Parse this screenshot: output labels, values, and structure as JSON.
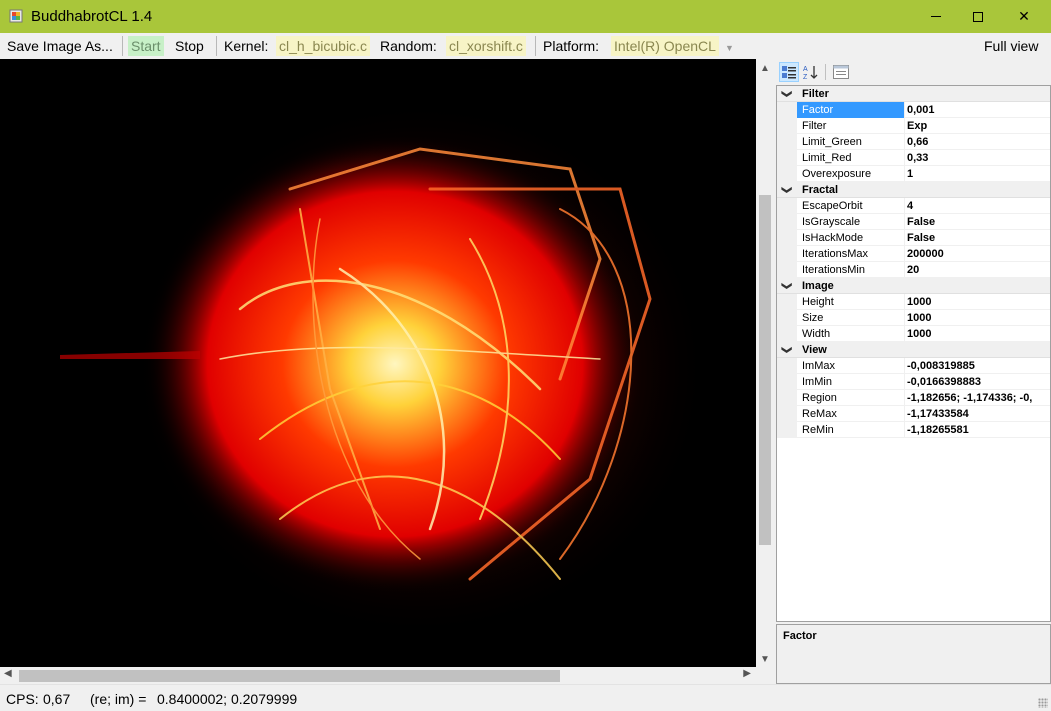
{
  "window": {
    "title": "BuddhabrotCL 1.4",
    "minimize_icon": "minimize-icon",
    "maximize_icon": "maximize-icon",
    "close_glyph": "✕"
  },
  "toolbar": {
    "save_label": "Save Image As...",
    "start_label": "Start",
    "stop_label": "Stop",
    "kernel_label": "Kernel:",
    "kernel_value": "cl_h_bicubic.c",
    "random_label": "Random:",
    "random_value": "cl_xorshift.c",
    "platform_label": "Platform:",
    "platform_value": "Intel(R) OpenCL",
    "full_view_label": "Full view"
  },
  "property_grid": {
    "toolbar_icons": [
      "categorized-icon",
      "alphabetical-icon",
      "property-pages-icon"
    ],
    "categories": [
      {
        "name": "Filter",
        "properties": [
          {
            "name": "Factor",
            "value": "0,001",
            "selected": true
          },
          {
            "name": "Filter",
            "value": "Exp"
          },
          {
            "name": "Limit_Green",
            "value": "0,66"
          },
          {
            "name": "Limit_Red",
            "value": "0,33"
          },
          {
            "name": "Overexposure",
            "value": "1"
          }
        ]
      },
      {
        "name": "Fractal",
        "properties": [
          {
            "name": "EscapeOrbit",
            "value": "4"
          },
          {
            "name": "IsGrayscale",
            "value": "False"
          },
          {
            "name": "IsHackMode",
            "value": "False"
          },
          {
            "name": "IterationsMax",
            "value": "200000"
          },
          {
            "name": "IterationsMin",
            "value": "20"
          }
        ]
      },
      {
        "name": "Image",
        "properties": [
          {
            "name": "Height",
            "value": "1000"
          },
          {
            "name": "Size",
            "value": "1000"
          },
          {
            "name": "Width",
            "value": "1000"
          }
        ]
      },
      {
        "name": "View",
        "properties": [
          {
            "name": "ImMax",
            "value": "-0,008319885"
          },
          {
            "name": "ImMin",
            "value": "-0,0166398883"
          },
          {
            "name": "Region",
            "value": "-1,182656; -1,174336; -0,"
          },
          {
            "name": "ReMax",
            "value": "-1,17433584"
          },
          {
            "name": "ReMin",
            "value": "-1,18265581"
          }
        ]
      }
    ],
    "help_title": "Factor"
  },
  "status": {
    "cps_label": "CPS:",
    "cps_value": "0,67",
    "coords_label": "(re; im) =",
    "coords_value": "0.8400002; 0.2079999"
  },
  "colors": {
    "titlebar": "#a9c63a",
    "selection": "#3399ff",
    "start_highlight": "#c7f0c7",
    "dropdown_highlight": "#f7f4c6",
    "fractal_red": "#ff1a00",
    "fractal_yellow": "#ffd23a"
  }
}
